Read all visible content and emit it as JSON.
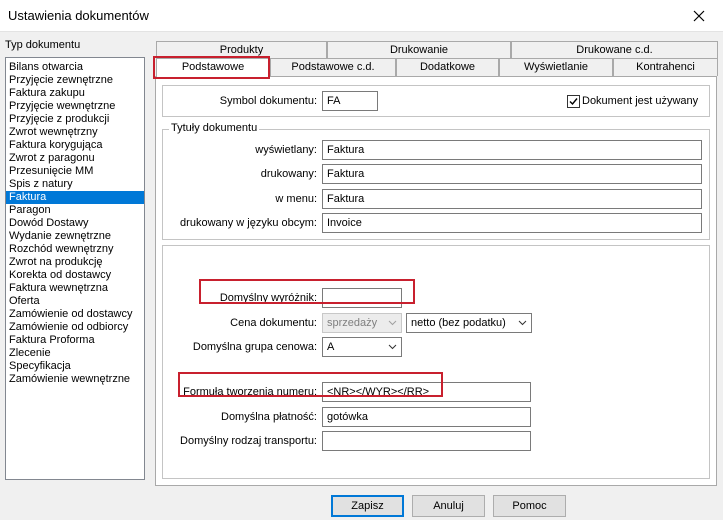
{
  "window": {
    "title": "Ustawienia dokumentów"
  },
  "left": {
    "label": "Typ dokumentu",
    "items": [
      "Bilans otwarcia",
      "Przyjęcie zewnętrzne",
      "Faktura zakupu",
      "Przyjęcie wewnętrzne",
      "Przyjęcie z produkcji",
      "Zwrot wewnętrzny",
      "Faktura korygująca",
      "Zwrot z paragonu",
      "Przesunięcie MM",
      "Spis z natury",
      "Faktura",
      "Paragon",
      "Dowód Dostawy",
      "Wydanie zewnętrzne",
      "Rozchód wewnętrzny",
      "Zwrot na produkcję",
      "Korekta od dostawcy",
      "Faktura wewnętrzna",
      "Oferta",
      "Zamówienie od dostawcy",
      "Zamówienie od odbiorcy",
      "Faktura Proforma",
      "Zlecenie",
      "Specyfikacja",
      "Zamówienie wewnętrzne"
    ],
    "selected": "Faktura"
  },
  "tabs": {
    "row1": [
      "Produkty",
      "Drukowanie",
      "Drukowane c.d."
    ],
    "row2": [
      "Podstawowe",
      "Podstawowe c.d.",
      "Dodatkowe",
      "Wyświetlanie",
      "Kontrahenci"
    ],
    "active": "Podstawowe"
  },
  "form": {
    "symbol_label": "Symbol dokumentu:",
    "symbol_value": "FA",
    "used_label": "Dokument jest używany",
    "used_checked": true,
    "titles_group": "Tytuły dokumentu",
    "displayed_label": "wyświetlany:",
    "displayed_value": "Faktura",
    "printed_label": "drukowany:",
    "printed_value": "Faktura",
    "menu_label": "w menu:",
    "menu_value": "Faktura",
    "foreign_label": "drukowany w języku obcym:",
    "foreign_value": "Invoice",
    "marker_label": "Domyślny wyróżnik:",
    "marker_value": "",
    "price_label": "Cena dokumentu:",
    "price_value": "sprzedaży",
    "tax_value": "netto (bez podatku)",
    "pricegroup_label": "Domyślna grupa cenowa:",
    "pricegroup_value": "A",
    "formula_label": "Formuła tworzenia numeru:",
    "formula_value": "<NR></WYR></RR>",
    "payment_label": "Domyślna płatność:",
    "payment_value": "gotówka",
    "transport_label": "Domyślny rodzaj transportu:",
    "transport_value": ""
  },
  "buttons": {
    "save": "Zapisz",
    "cancel": "Anuluj",
    "help": "Pomoc"
  },
  "colors": {
    "selection": "#0078d7",
    "highlight": "#c8202e"
  }
}
